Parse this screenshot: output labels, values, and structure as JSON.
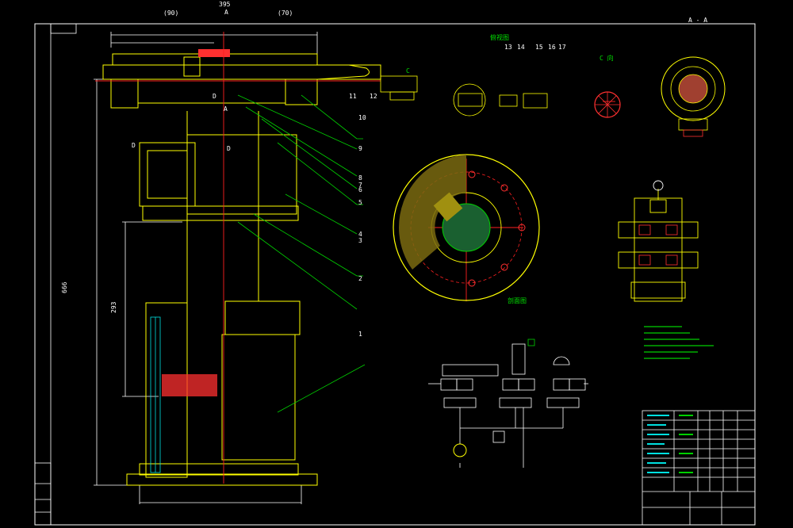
{
  "drawing": {
    "top_dim_main": "395",
    "top_section_A": "A",
    "top_dim_left": "(90)",
    "top_dim_right": "(70)",
    "section_aa_title": "A - A",
    "dim_height": "666",
    "dim_inner_height": "293",
    "view_c_title": "C 向",
    "detail_title_prefix": "俯视图",
    "part_numbers_top": [
      "13",
      "14",
      "15",
      "16",
      "17"
    ],
    "part_numbers_side": [
      "9",
      "8",
      "7",
      "6",
      "5",
      "4",
      "3",
      "2",
      "1",
      "10",
      "11",
      "12"
    ],
    "part_letter_c": "C",
    "part_letters_d": [
      "D",
      "D",
      "D"
    ],
    "label_a_small": "A",
    "section_label": "剖面图"
  },
  "colors": {
    "background": "#000000",
    "outline": "#ffffff",
    "body": "#ffff00",
    "centerline": "#ff2020",
    "leader": "#00d000",
    "inner": "#00e0e0",
    "hatch": "#ff3030",
    "accent": "#ff00ff"
  }
}
